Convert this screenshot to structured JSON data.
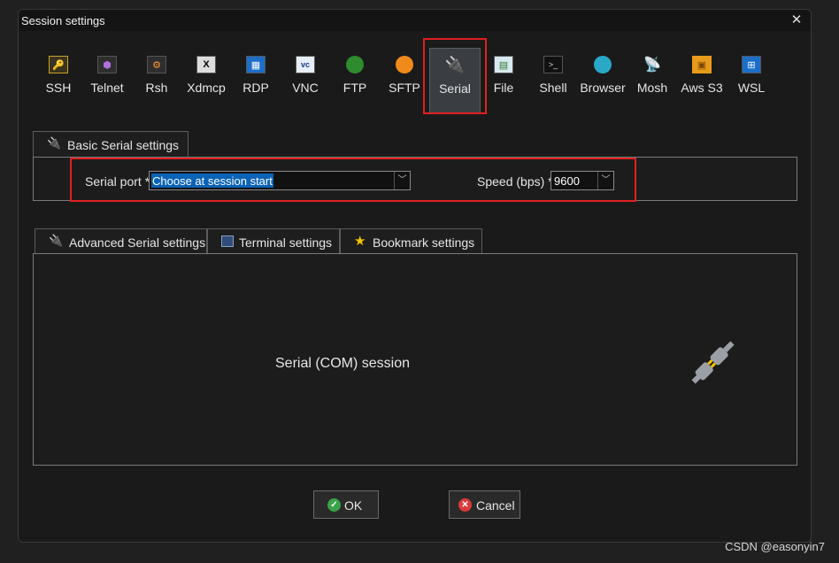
{
  "window": {
    "title": "Session settings"
  },
  "toolbar": {
    "items": [
      {
        "label": "SSH",
        "icon": "ssh-key-icon"
      },
      {
        "label": "Telnet",
        "icon": "telnet-icon"
      },
      {
        "label": "Rsh",
        "icon": "rsh-icon"
      },
      {
        "label": "Xdmcp",
        "icon": "xdmcp-icon"
      },
      {
        "label": "RDP",
        "icon": "rdp-icon"
      },
      {
        "label": "VNC",
        "icon": "vnc-icon"
      },
      {
        "label": "FTP",
        "icon": "ftp-globe-icon"
      },
      {
        "label": "SFTP",
        "icon": "sftp-globe-icon"
      },
      {
        "label": "Serial",
        "icon": "serial-plug-icon",
        "selected": true
      },
      {
        "label": "File",
        "icon": "file-icon"
      },
      {
        "label": "Shell",
        "icon": "shell-terminal-icon"
      },
      {
        "label": "Browser",
        "icon": "browser-globe-icon"
      },
      {
        "label": "Mosh",
        "icon": "mosh-satellite-icon"
      },
      {
        "label": "Aws S3",
        "icon": "aws-s3-icon"
      },
      {
        "label": "WSL",
        "icon": "wsl-windows-icon"
      }
    ]
  },
  "basic": {
    "tab_label": "Basic Serial settings",
    "serial_port_label": "Serial port *",
    "serial_port_value": "Choose at session start",
    "speed_label": "Speed (bps) *",
    "speed_value": "9600"
  },
  "tabs": [
    {
      "label": "Advanced Serial settings",
      "icon": "plug-icon"
    },
    {
      "label": "Terminal settings",
      "icon": "terminal-settings-icon"
    },
    {
      "label": "Bookmark settings",
      "icon": "star-icon"
    }
  ],
  "content": {
    "text": "Serial (COM) session"
  },
  "buttons": {
    "ok": "OK",
    "cancel": "Cancel"
  },
  "watermark": "CSDN @easonyin7",
  "colors": {
    "accent": "#0b63b6",
    "highlight": "#e02020",
    "ok": "#3aa34a",
    "cancel": "#d93b3b"
  }
}
